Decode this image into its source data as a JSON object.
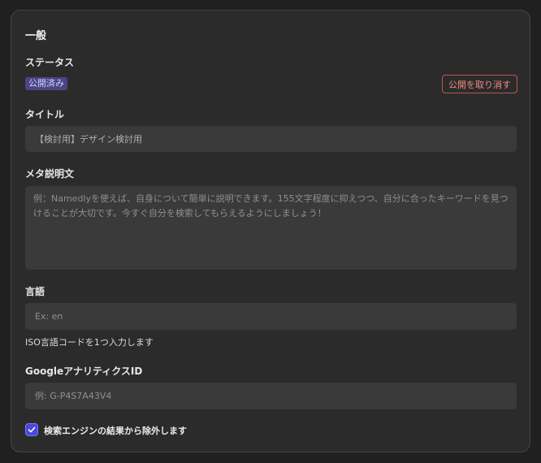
{
  "general": {
    "title": "一般",
    "status": {
      "label": "ステータス",
      "badge": "公開済み",
      "unpublish_button": "公開を取り消す"
    },
    "title_field": {
      "label": "タイトル",
      "value": "【検討用】デザイン検討用"
    },
    "meta_description": {
      "label": "メタ説明文",
      "placeholder": "例：Namedlyを使えば、自身について簡単に説明できます。155文字程度に抑えつつ、自分に合ったキーワードを見つけることが大切です。今すぐ自分を検索してもらえるようにしましょう！"
    },
    "language": {
      "label": "言語",
      "placeholder": "Ex: en",
      "help": "ISO言語コードを1つ入力します"
    },
    "google_analytics": {
      "label": "GoogleアナリティクスID",
      "placeholder": "例: G-P4S7A43V4"
    },
    "exclude_search": {
      "label": "検索エンジンの結果から除外します",
      "checked": true
    }
  },
  "colors": {
    "accent": "#4d47d9",
    "badge_bg": "#4a4585",
    "danger": "#f28b82"
  }
}
